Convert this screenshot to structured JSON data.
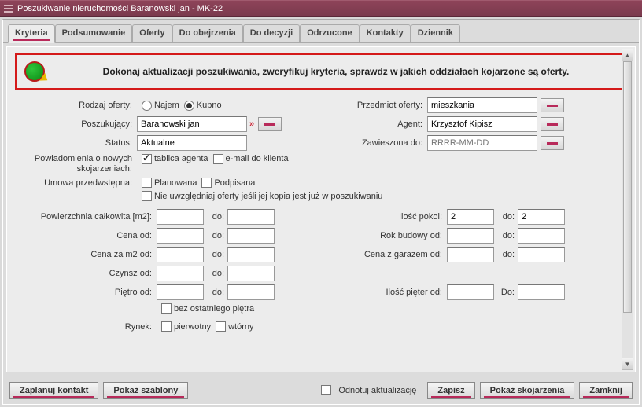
{
  "window": {
    "title": "Poszukiwanie nieruchomości Baranowski jan - MK-22"
  },
  "tabs": [
    {
      "label": "Kryteria",
      "active": true
    },
    {
      "label": "Podsumowanie"
    },
    {
      "label": "Oferty"
    },
    {
      "label": "Do obejrzenia"
    },
    {
      "label": "Do decyzji"
    },
    {
      "label": "Odrzucone"
    },
    {
      "label": "Kontakty"
    },
    {
      "label": "Dziennik"
    }
  ],
  "alert": "Dokonaj aktualizacji poszukiwania, zweryfikuj kryteria, sprawdz w jakich oddziałach kojarzone są oferty.",
  "form": {
    "rodzaj_oferty_label": "Rodzaj oferty:",
    "rodzaj_oferty_opts": {
      "najem": "Najem",
      "kupno": "Kupno"
    },
    "rodzaj_selected": "kupno",
    "przedmiot_label": "Przedmiot oferty:",
    "przedmiot_value": "mieszkania",
    "poszukujacy_label": "Poszukujący:",
    "poszukujacy_value": "Baranowski jan",
    "agent_label": "Agent:",
    "agent_value": "Krzysztof Kipisz",
    "status_label": "Status:",
    "status_value": "Aktualne",
    "zawieszona_label": "Zawieszona do:",
    "zawieszona_placeholder": "RRRR-MM-DD",
    "powiadomienia_label": "Powiadomienia o nowych skojarzeniach:",
    "powiadomienia_tablica": "tablica agenta",
    "powiadomienia_email": "e-mail do klienta",
    "umowa_label": "Umowa przedwstępna:",
    "umowa_planowana": "Planowana",
    "umowa_podpisana": "Podpisana",
    "exclude_copy": "Nie uwzględniaj oferty jeśli jej kopia jest już w poszukiwaniu",
    "arrows": "»"
  },
  "ranges": {
    "do": "do:",
    "Do": "Do:",
    "left": [
      {
        "label": "Powierzchnia całkowita [m2]:",
        "from": "",
        "to": ""
      },
      {
        "label": "Cena od:",
        "from": "",
        "to": ""
      },
      {
        "label": "Cena za m2 od:",
        "from": "",
        "to": ""
      },
      {
        "label": "Czynsz od:",
        "from": "",
        "to": ""
      },
      {
        "label": "Piętro od:",
        "from": "",
        "to": ""
      }
    ],
    "bez_ostatniego": "bez ostatniego piętra",
    "right": [
      {
        "label": "Ilość pokoi:",
        "from": "2",
        "to": "2"
      },
      {
        "label": "Rok budowy od:",
        "from": "",
        "to": ""
      },
      {
        "label": "Cena z garażem od:",
        "from": "",
        "to": ""
      },
      {
        "label": "",
        "from": "",
        "to": ""
      },
      {
        "label": "Ilość pięter od:",
        "from": "",
        "to": ""
      }
    ],
    "rynek_label": "Rynek:",
    "rynek_pierwotny": "pierwotny",
    "rynek_wtorny": "wtórny"
  },
  "footer": {
    "zaplanuj": "Zaplanuj kontakt",
    "szablony": "Pokaż szablony",
    "odnotuj": "Odnotuj aktualizację",
    "zapisz": "Zapisz",
    "skojarzenia": "Pokaż skojarzenia",
    "zamknij": "Zamknij"
  }
}
